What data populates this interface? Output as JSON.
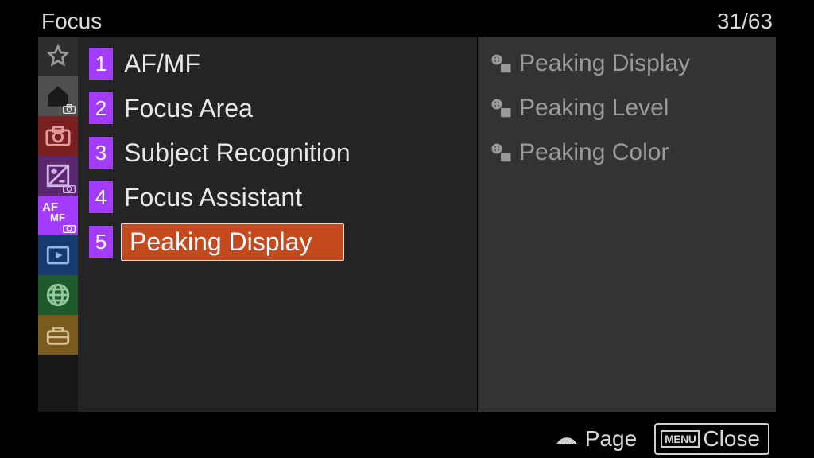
{
  "header": {
    "title": "Focus",
    "page_current": "31",
    "page_total": "63"
  },
  "sidebar": {
    "items": [
      {
        "id": "fav",
        "icon": "star-icon"
      },
      {
        "id": "main",
        "icon": "home-icon",
        "overlay": "camera"
      },
      {
        "id": "shoot",
        "icon": "camera-icon"
      },
      {
        "id": "expo",
        "icon": "exposure-icon",
        "overlay": "camera"
      },
      {
        "id": "focus",
        "icon": "afmf-icon",
        "overlay": "camera",
        "active": true
      },
      {
        "id": "play",
        "icon": "play-icon"
      },
      {
        "id": "net",
        "icon": "globe-icon"
      },
      {
        "id": "setup",
        "icon": "toolbox-icon"
      }
    ]
  },
  "menu": {
    "items": [
      {
        "num": "1",
        "label": "AF/MF"
      },
      {
        "num": "2",
        "label": "Focus Area"
      },
      {
        "num": "3",
        "label": "Subject Recognition"
      },
      {
        "num": "4",
        "label": "Focus Assistant"
      },
      {
        "num": "5",
        "label": "Peaking Display",
        "selected": true
      }
    ]
  },
  "submenu": {
    "items": [
      {
        "label": "Peaking Display"
      },
      {
        "label": "Peaking Level"
      },
      {
        "label": "Peaking Color"
      }
    ]
  },
  "footer": {
    "page_label": "Page",
    "close_label": "Close",
    "close_badge": "MENU"
  }
}
